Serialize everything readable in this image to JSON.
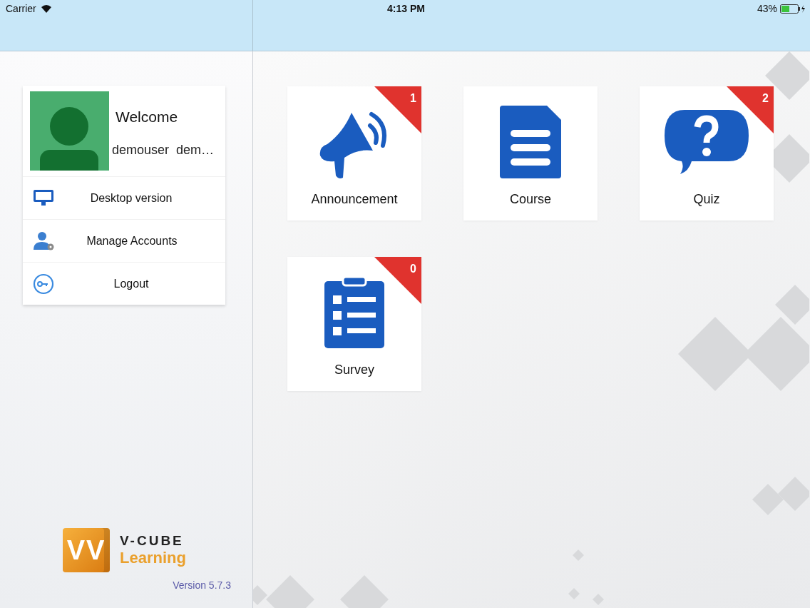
{
  "status_bar": {
    "carrier": "Carrier",
    "time": "4:13 PM",
    "battery": "43%"
  },
  "profile": {
    "greeting": "Welcome",
    "user": "demouser  dem…"
  },
  "menu": [
    {
      "kind": "desktop",
      "label": "Desktop version"
    },
    {
      "kind": "accounts",
      "label": "Manage Accounts"
    },
    {
      "kind": "logout",
      "label": "Logout"
    }
  ],
  "logo": {
    "mark": "VV",
    "brand": "V-CUBE",
    "product": "Learning"
  },
  "version": "Version 5.7.3",
  "tiles": [
    {
      "kind": "announcement",
      "label": "Announcement",
      "badge": "1"
    },
    {
      "kind": "course",
      "label": "Course"
    },
    {
      "kind": "quiz",
      "label": "Quiz",
      "badge": "2"
    },
    {
      "kind": "survey",
      "label": "Survey",
      "badge": "0"
    }
  ]
}
